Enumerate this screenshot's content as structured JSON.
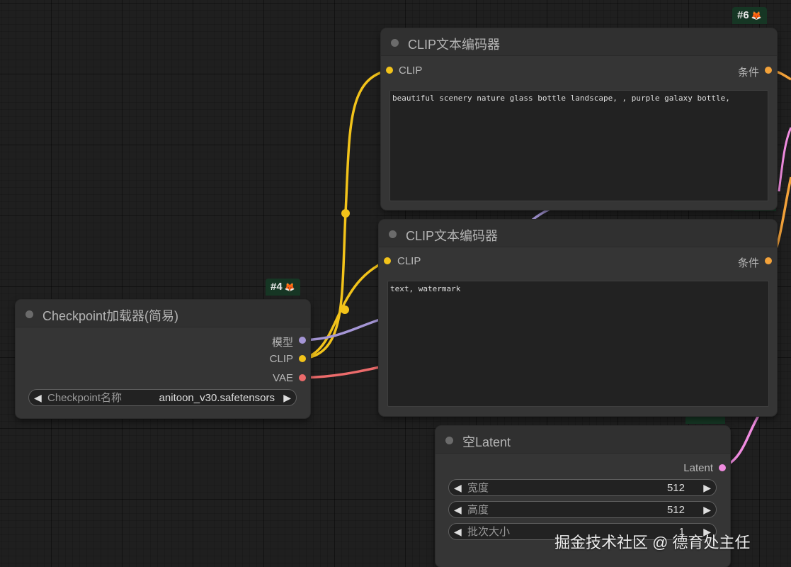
{
  "nodes": {
    "clip_text_encoder_1": {
      "badge": "#6",
      "badge_icon": "fox-icon",
      "title": "CLIP文本编码器",
      "input_clip": "CLIP",
      "output_conditioning": "条件",
      "text": "beautiful scenery nature glass bottle landscape, , purple galaxy bottle,"
    },
    "clip_text_encoder_2": {
      "title": "CLIP文本编码器",
      "input_clip": "CLIP",
      "output_conditioning": "条件",
      "text": "text, watermark"
    },
    "checkpoint_loader": {
      "badge": "#4",
      "badge_icon": "fox-icon",
      "title": "Checkpoint加载器(简易)",
      "output_model": "模型",
      "output_clip": "CLIP",
      "output_vae": "VAE",
      "widget_label": "Checkpoint名称",
      "widget_value": "anitoon_v30.safetensors"
    },
    "empty_latent": {
      "title": "空Latent",
      "output_latent": "Latent",
      "width_label": "宽度",
      "width_value": "512",
      "height_label": "高度",
      "height_value": "512",
      "batch_label": "批次大小",
      "batch_value": "1"
    }
  },
  "watermark": "掘金技术社区 @ 德育处主任",
  "colors": {
    "clip_link": "#f2c31a",
    "model_link": "#a596d6",
    "vae_link": "#ec6b6b",
    "conditioning_link": "#f3a23a",
    "latent_link": "#f08ce0",
    "badge_bg": "#163624",
    "node_bg": "#353535",
    "canvas_bg": "#1f1f1f"
  }
}
